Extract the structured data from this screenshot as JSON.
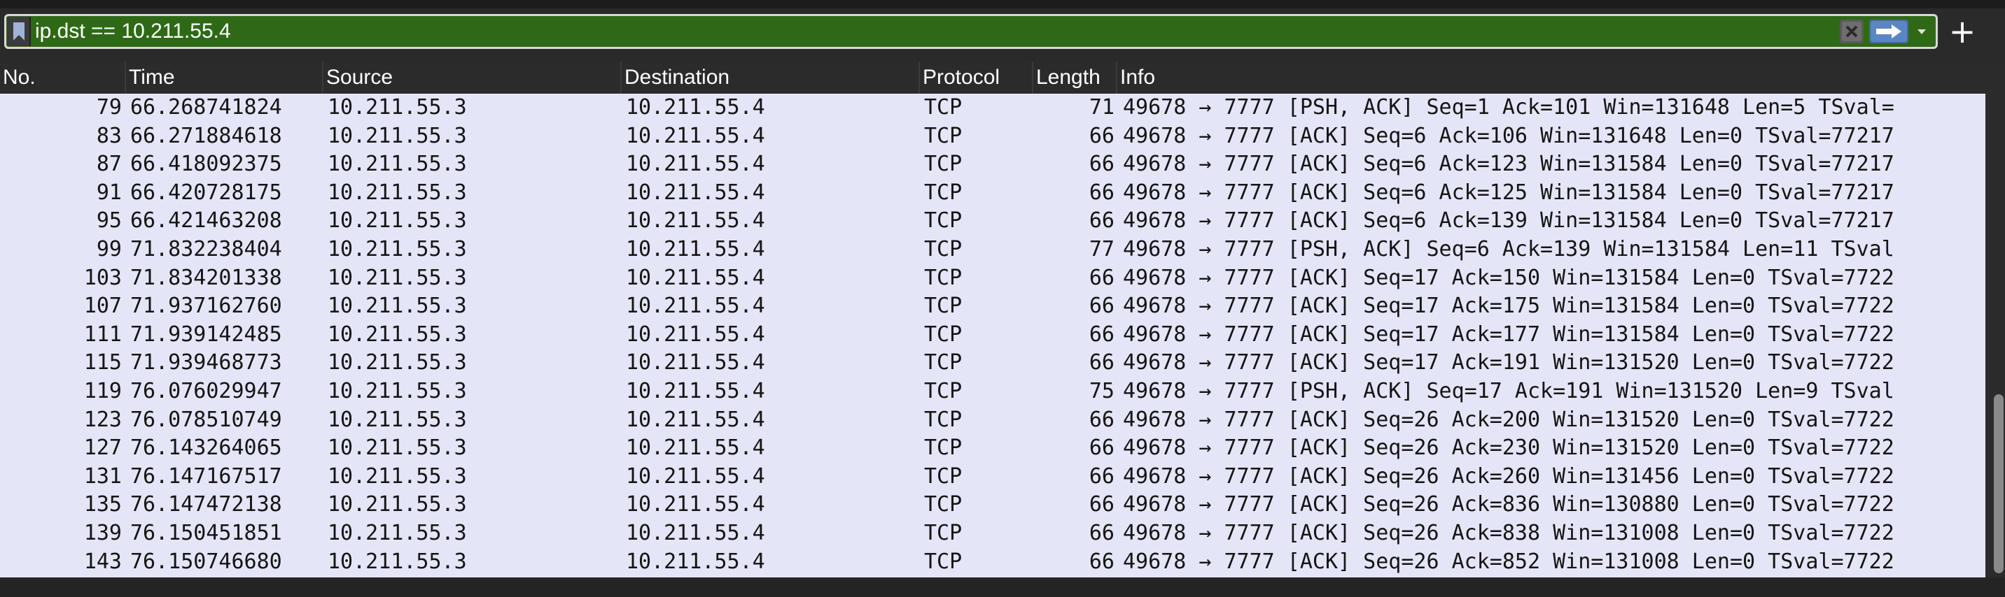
{
  "filter": {
    "expression": "ip.dst == 10.211.55.4",
    "add_button": "+"
  },
  "colors": {
    "filter_valid_bg": "#2e6a16",
    "row_bg": "#e5e5f8",
    "header_bg": "#2b2b2b"
  },
  "icons": {
    "bookmark": "bookmark-icon",
    "clear": "clear-icon",
    "apply": "arrow-right-icon",
    "dropdown": "chevron-down-icon",
    "add": "plus-icon"
  },
  "columns": {
    "no": "No.",
    "time": "Time",
    "source": "Source",
    "destination": "Destination",
    "protocol": "Protocol",
    "length": "Length",
    "info": "Info"
  },
  "packets": [
    {
      "no": "79",
      "time": "66.268741824",
      "source": "10.211.55.3",
      "destination": "10.211.55.4",
      "protocol": "TCP",
      "length": "71",
      "info": "49678 → 7777 [PSH, ACK] Seq=1 Ack=101 Win=131648 Len=5 TSval="
    },
    {
      "no": "83",
      "time": "66.271884618",
      "source": "10.211.55.3",
      "destination": "10.211.55.4",
      "protocol": "TCP",
      "length": "66",
      "info": "49678 → 7777 [ACK] Seq=6 Ack=106 Win=131648 Len=0 TSval=77217"
    },
    {
      "no": "87",
      "time": "66.418092375",
      "source": "10.211.55.3",
      "destination": "10.211.55.4",
      "protocol": "TCP",
      "length": "66",
      "info": "49678 → 7777 [ACK] Seq=6 Ack=123 Win=131584 Len=0 TSval=77217"
    },
    {
      "no": "91",
      "time": "66.420728175",
      "source": "10.211.55.3",
      "destination": "10.211.55.4",
      "protocol": "TCP",
      "length": "66",
      "info": "49678 → 7777 [ACK] Seq=6 Ack=125 Win=131584 Len=0 TSval=77217"
    },
    {
      "no": "95",
      "time": "66.421463208",
      "source": "10.211.55.3",
      "destination": "10.211.55.4",
      "protocol": "TCP",
      "length": "66",
      "info": "49678 → 7777 [ACK] Seq=6 Ack=139 Win=131584 Len=0 TSval=77217"
    },
    {
      "no": "99",
      "time": "71.832238404",
      "source": "10.211.55.3",
      "destination": "10.211.55.4",
      "protocol": "TCP",
      "length": "77",
      "info": "49678 → 7777 [PSH, ACK] Seq=6 Ack=139 Win=131584 Len=11 TSval"
    },
    {
      "no": "103",
      "time": "71.834201338",
      "source": "10.211.55.3",
      "destination": "10.211.55.4",
      "protocol": "TCP",
      "length": "66",
      "info": "49678 → 7777 [ACK] Seq=17 Ack=150 Win=131584 Len=0 TSval=7722"
    },
    {
      "no": "107",
      "time": "71.937162760",
      "source": "10.211.55.3",
      "destination": "10.211.55.4",
      "protocol": "TCP",
      "length": "66",
      "info": "49678 → 7777 [ACK] Seq=17 Ack=175 Win=131584 Len=0 TSval=7722"
    },
    {
      "no": "111",
      "time": "71.939142485",
      "source": "10.211.55.3",
      "destination": "10.211.55.4",
      "protocol": "TCP",
      "length": "66",
      "info": "49678 → 7777 [ACK] Seq=17 Ack=177 Win=131584 Len=0 TSval=7722"
    },
    {
      "no": "115",
      "time": "71.939468773",
      "source": "10.211.55.3",
      "destination": "10.211.55.4",
      "protocol": "TCP",
      "length": "66",
      "info": "49678 → 7777 [ACK] Seq=17 Ack=191 Win=131520 Len=0 TSval=7722"
    },
    {
      "no": "119",
      "time": "76.076029947",
      "source": "10.211.55.3",
      "destination": "10.211.55.4",
      "protocol": "TCP",
      "length": "75",
      "info": "49678 → 7777 [PSH, ACK] Seq=17 Ack=191 Win=131520 Len=9 TSval"
    },
    {
      "no": "123",
      "time": "76.078510749",
      "source": "10.211.55.3",
      "destination": "10.211.55.4",
      "protocol": "TCP",
      "length": "66",
      "info": "49678 → 7777 [ACK] Seq=26 Ack=200 Win=131520 Len=0 TSval=7722"
    },
    {
      "no": "127",
      "time": "76.143264065",
      "source": "10.211.55.3",
      "destination": "10.211.55.4",
      "protocol": "TCP",
      "length": "66",
      "info": "49678 → 7777 [ACK] Seq=26 Ack=230 Win=131520 Len=0 TSval=7722"
    },
    {
      "no": "131",
      "time": "76.147167517",
      "source": "10.211.55.3",
      "destination": "10.211.55.4",
      "protocol": "TCP",
      "length": "66",
      "info": "49678 → 7777 [ACK] Seq=26 Ack=260 Win=131456 Len=0 TSval=7722"
    },
    {
      "no": "135",
      "time": "76.147472138",
      "source": "10.211.55.3",
      "destination": "10.211.55.4",
      "protocol": "TCP",
      "length": "66",
      "info": "49678 → 7777 [ACK] Seq=26 Ack=836 Win=130880 Len=0 TSval=7722"
    },
    {
      "no": "139",
      "time": "76.150451851",
      "source": "10.211.55.3",
      "destination": "10.211.55.4",
      "protocol": "TCP",
      "length": "66",
      "info": "49678 → 7777 [ACK] Seq=26 Ack=838 Win=131008 Len=0 TSval=7722"
    },
    {
      "no": "143",
      "time": "76.150746680",
      "source": "10.211.55.3",
      "destination": "10.211.55.4",
      "protocol": "TCP",
      "length": "66",
      "info": "49678 → 7777 [ACK] Seq=26 Ack=852 Win=131008 Len=0 TSval=7722"
    }
  ]
}
